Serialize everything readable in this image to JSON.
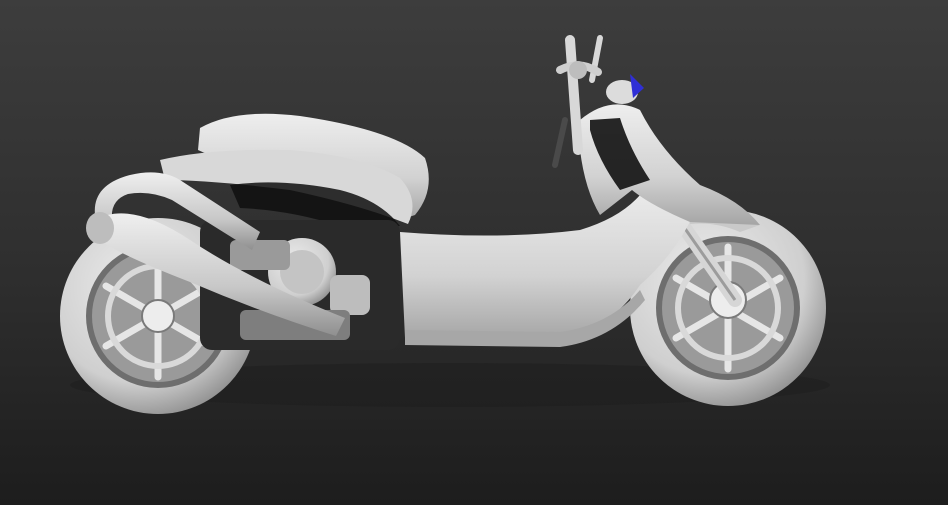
{
  "viewport": {
    "background_top": "#3b3b3b",
    "background_bottom": "#1f1f1f",
    "model_color": "#d7d7d7",
    "model_shadow": "#8a8a8a",
    "accent_marker": "#2f2fd6",
    "subject": "motorcycle-3d-model"
  }
}
